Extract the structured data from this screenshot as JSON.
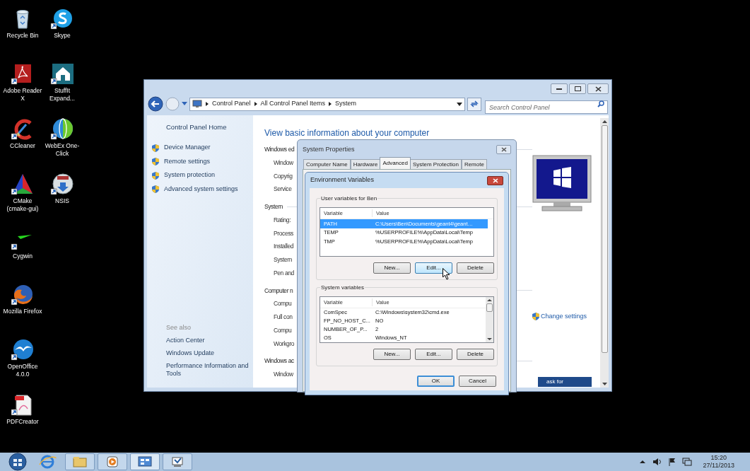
{
  "desktop_icons": [
    {
      "label": "Recycle Bin",
      "kind": "recycle"
    },
    {
      "label": "Adobe Reader X",
      "kind": "adobe"
    },
    {
      "label": "CCleaner",
      "kind": "ccleaner"
    },
    {
      "label": "CMake (cmake-gui)",
      "kind": "cmake"
    },
    {
      "label": "Cygwin",
      "kind": "cygwin"
    },
    {
      "label": "Mozilla Firefox",
      "kind": "firefox"
    },
    {
      "label": "OpenOffice 4.0.0",
      "kind": "openoffice"
    },
    {
      "label": "PDFCreator",
      "kind": "pdfcreator"
    },
    {
      "label": "Skype",
      "kind": "skype"
    },
    {
      "label": "StuffIt Expand...",
      "kind": "stuffit"
    },
    {
      "label": "WebEx One-Click",
      "kind": "webex"
    },
    {
      "label": "NSIS",
      "kind": "nsis"
    }
  ],
  "control_panel": {
    "breadcrumb": [
      "Control Panel",
      "All Control Panel Items",
      "System"
    ],
    "search": {
      "placeholder": "Search Control Panel"
    },
    "left_pane": {
      "home": "Control Panel Home",
      "tasks": [
        "Device Manager",
        "Remote settings",
        "System protection",
        "Advanced system settings"
      ],
      "see_also_title": "See also",
      "see_also": [
        "Action Center",
        "Windows Update",
        "Performance Information and Tools"
      ]
    },
    "heading": "View basic information about your computer",
    "sections": [
      {
        "title": "Windows ed",
        "rows": [
          "Window",
          "Copyrig",
          "Service"
        ]
      },
      {
        "title": "System",
        "rows": [
          "Rating:",
          "Process",
          "Installed",
          "System",
          "Pen and"
        ]
      },
      {
        "title": "Computer n",
        "rows": [
          "Compu",
          "Full con",
          "Compu",
          "Workgro"
        ]
      },
      {
        "title": "Windows ac",
        "rows": [
          "Window"
        ]
      }
    ],
    "change_settings": "Change settings",
    "ask_button": "ask for"
  },
  "system_properties": {
    "title": "System Properties",
    "tabs": [
      {
        "label": "Computer Name",
        "selected": false
      },
      {
        "label": "Hardware",
        "selected": false
      },
      {
        "label": "Advanced",
        "selected": true
      },
      {
        "label": "System Protection",
        "selected": false
      },
      {
        "label": "Remote",
        "selected": false
      }
    ]
  },
  "environment_variables": {
    "title": "Environment Variables",
    "groups": [
      {
        "title": "User variables for Ben",
        "columns": [
          "Variable",
          "Value"
        ],
        "scrollbar": false,
        "rows": [
          {
            "variable": "PATH",
            "value": "C:\\Users\\Ben\\Documents\\geant4\\geant…",
            "selected": true
          },
          {
            "variable": "TEMP",
            "value": "%USERPROFILE%\\AppData\\Local\\Temp",
            "selected": false
          },
          {
            "variable": "TMP",
            "value": "%USERPROFILE%\\AppData\\Local\\Temp",
            "selected": false
          }
        ],
        "buttons": [
          {
            "label": "New...",
            "hot": false
          },
          {
            "label": "Edit...",
            "hot": true
          },
          {
            "label": "Delete",
            "hot": false
          }
        ]
      },
      {
        "title": "System variables",
        "columns": [
          "Variable",
          "Value"
        ],
        "scrollbar": true,
        "rows": [
          {
            "variable": "ComSpec",
            "value": "C:\\Windows\\system32\\cmd.exe",
            "selected": false
          },
          {
            "variable": "FP_NO_HOST_C...",
            "value": "NO",
            "selected": false
          },
          {
            "variable": "NUMBER_OF_P...",
            "value": "2",
            "selected": false
          },
          {
            "variable": "OS",
            "value": "Windows_NT",
            "selected": false
          }
        ],
        "buttons": [
          {
            "label": "New...",
            "hot": false
          },
          {
            "label": "Edit...",
            "hot": false
          },
          {
            "label": "Delete",
            "hot": false
          }
        ]
      }
    ],
    "buttons": [
      {
        "label": "OK",
        "default": true
      },
      {
        "label": "Cancel",
        "default": false
      }
    ]
  },
  "taskbar": {
    "time": "15:20",
    "date": "27/11/2013"
  }
}
